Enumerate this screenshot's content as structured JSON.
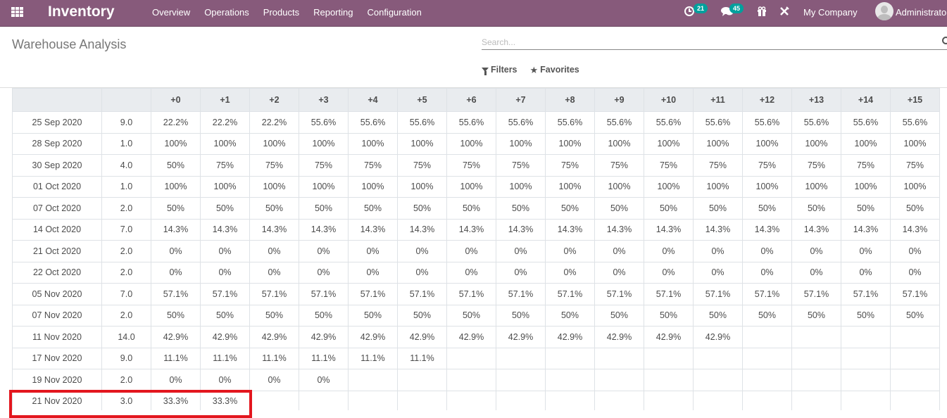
{
  "navbar": {
    "app_title": "Inventory",
    "menu": [
      "Overview",
      "Operations",
      "Products",
      "Reporting",
      "Configuration"
    ],
    "activity_count": "21",
    "messages_count": "45",
    "company": "My Company",
    "user": "Administrator"
  },
  "control_panel": {
    "title": "Warehouse Analysis",
    "search_placeholder": "Search...",
    "filters_label": "Filters",
    "favorites_label": "Favorites"
  },
  "cohort": {
    "columns": [
      "+0",
      "+1",
      "+2",
      "+3",
      "+4",
      "+5",
      "+6",
      "+7",
      "+8",
      "+9",
      "+10",
      "+11",
      "+12",
      "+13",
      "+14",
      "+15"
    ],
    "rows": [
      {
        "date": "25 Sep 2020",
        "count": "9.0",
        "values": [
          "22.2%",
          "22.2%",
          "22.2%",
          "55.6%",
          "55.6%",
          "55.6%",
          "55.6%",
          "55.6%",
          "55.6%",
          "55.6%",
          "55.6%",
          "55.6%",
          "55.6%",
          "55.6%",
          "55.6%",
          "55.6%"
        ]
      },
      {
        "date": "28 Sep 2020",
        "count": "1.0",
        "values": [
          "100%",
          "100%",
          "100%",
          "100%",
          "100%",
          "100%",
          "100%",
          "100%",
          "100%",
          "100%",
          "100%",
          "100%",
          "100%",
          "100%",
          "100%",
          "100%"
        ]
      },
      {
        "date": "30 Sep 2020",
        "count": "4.0",
        "values": [
          "50%",
          "75%",
          "75%",
          "75%",
          "75%",
          "75%",
          "75%",
          "75%",
          "75%",
          "75%",
          "75%",
          "75%",
          "75%",
          "75%",
          "75%",
          "75%"
        ]
      },
      {
        "date": "01 Oct 2020",
        "count": "1.0",
        "values": [
          "100%",
          "100%",
          "100%",
          "100%",
          "100%",
          "100%",
          "100%",
          "100%",
          "100%",
          "100%",
          "100%",
          "100%",
          "100%",
          "100%",
          "100%",
          "100%"
        ]
      },
      {
        "date": "07 Oct 2020",
        "count": "2.0",
        "values": [
          "50%",
          "50%",
          "50%",
          "50%",
          "50%",
          "50%",
          "50%",
          "50%",
          "50%",
          "50%",
          "50%",
          "50%",
          "50%",
          "50%",
          "50%",
          "50%"
        ]
      },
      {
        "date": "14 Oct 2020",
        "count": "7.0",
        "values": [
          "14.3%",
          "14.3%",
          "14.3%",
          "14.3%",
          "14.3%",
          "14.3%",
          "14.3%",
          "14.3%",
          "14.3%",
          "14.3%",
          "14.3%",
          "14.3%",
          "14.3%",
          "14.3%",
          "14.3%",
          "14.3%"
        ]
      },
      {
        "date": "21 Oct 2020",
        "count": "2.0",
        "values": [
          "0%",
          "0%",
          "0%",
          "0%",
          "0%",
          "0%",
          "0%",
          "0%",
          "0%",
          "0%",
          "0%",
          "0%",
          "0%",
          "0%",
          "0%",
          "0%"
        ]
      },
      {
        "date": "22 Oct 2020",
        "count": "2.0",
        "values": [
          "0%",
          "0%",
          "0%",
          "0%",
          "0%",
          "0%",
          "0%",
          "0%",
          "0%",
          "0%",
          "0%",
          "0%",
          "0%",
          "0%",
          "0%",
          "0%"
        ]
      },
      {
        "date": "05 Nov 2020",
        "count": "7.0",
        "values": [
          "57.1%",
          "57.1%",
          "57.1%",
          "57.1%",
          "57.1%",
          "57.1%",
          "57.1%",
          "57.1%",
          "57.1%",
          "57.1%",
          "57.1%",
          "57.1%",
          "57.1%",
          "57.1%",
          "57.1%",
          "57.1%"
        ]
      },
      {
        "date": "07 Nov 2020",
        "count": "2.0",
        "values": [
          "50%",
          "50%",
          "50%",
          "50%",
          "50%",
          "50%",
          "50%",
          "50%",
          "50%",
          "50%",
          "50%",
          "50%",
          "50%",
          "50%",
          "50%",
          "50%"
        ]
      },
      {
        "date": "11 Nov 2020",
        "count": "14.0",
        "values": [
          "42.9%",
          "42.9%",
          "42.9%",
          "42.9%",
          "42.9%",
          "42.9%",
          "42.9%",
          "42.9%",
          "42.9%",
          "42.9%",
          "42.9%",
          "42.9%",
          "",
          "",
          "",
          ""
        ]
      },
      {
        "date": "17 Nov 2020",
        "count": "9.0",
        "values": [
          "11.1%",
          "11.1%",
          "11.1%",
          "11.1%",
          "11.1%",
          "11.1%",
          "",
          "",
          "",
          "",
          "",
          "",
          "",
          "",
          "",
          ""
        ]
      },
      {
        "date": "19 Nov 2020",
        "count": "2.0",
        "values": [
          "0%",
          "0%",
          "0%",
          "0%",
          "",
          "",
          "",
          "",
          "",
          "",
          "",
          "",
          "",
          "",
          "",
          ""
        ]
      },
      {
        "date": "21 Nov 2020",
        "count": "3.0",
        "values": [
          "33.3%",
          "33.3%",
          "",
          "",
          "",
          "",
          "",
          "",
          "",
          "",
          "",
          "",
          "",
          "",
          "",
          ""
        ]
      }
    ],
    "highlighted_row": "21 Nov 2020",
    "highlight_color": "#e3161e"
  },
  "colors": {
    "navbar": "#875a7b",
    "badge": "#00a09d",
    "header_bg": "#e9ecef"
  }
}
